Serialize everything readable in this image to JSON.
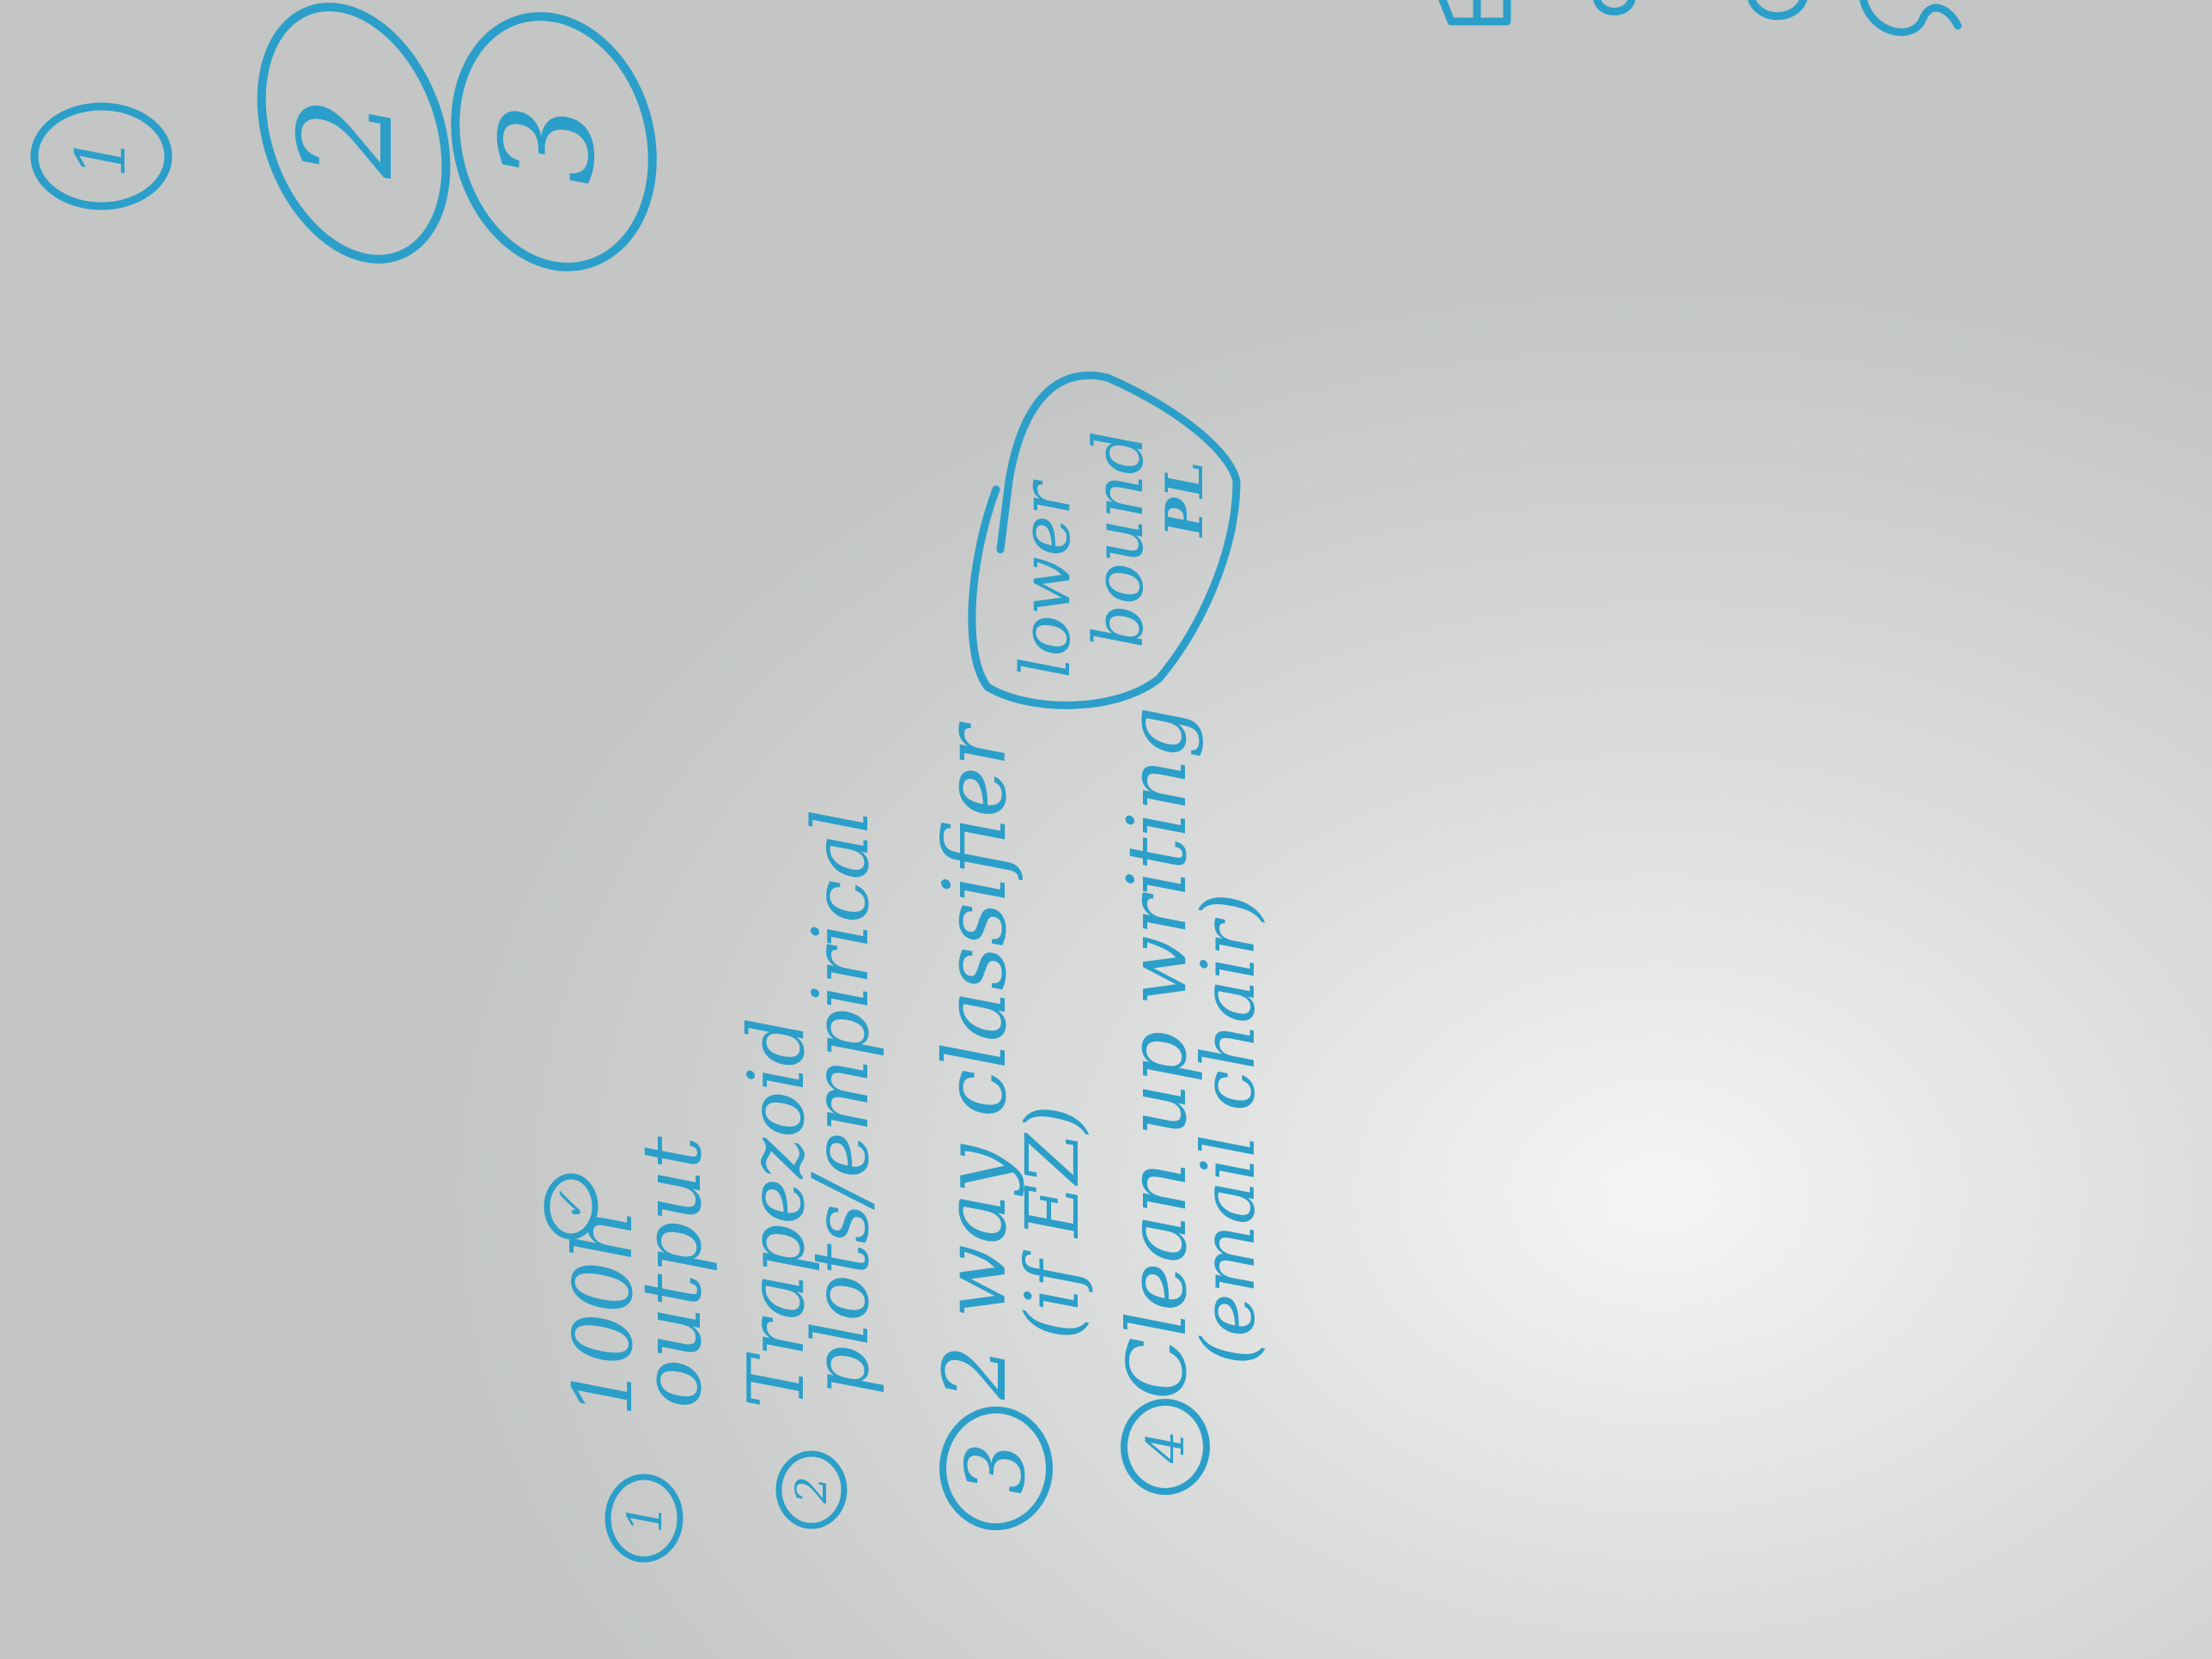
{
  "colors": {
    "ink": "#2b9fc9",
    "board": "#cdd0cf"
  },
  "top_circles": [
    "1",
    "2",
    "3"
  ],
  "todo_list": [
    {
      "number": "1",
      "lines": [
        "100h",
        "output"
      ],
      "check": "✓"
    },
    {
      "number": "2",
      "lines": [
        "Trapezoid",
        "plots/empirical"
      ]
    },
    {
      "number": "3",
      "lines": [
        "2 way classifier",
        "(if EZ)"
      ]
    },
    {
      "number": "4",
      "lines": [
        "Clean up writing",
        "(email chair)"
      ]
    }
  ],
  "bubble": {
    "lines": [
      "lower",
      "bound",
      "PL"
    ]
  }
}
